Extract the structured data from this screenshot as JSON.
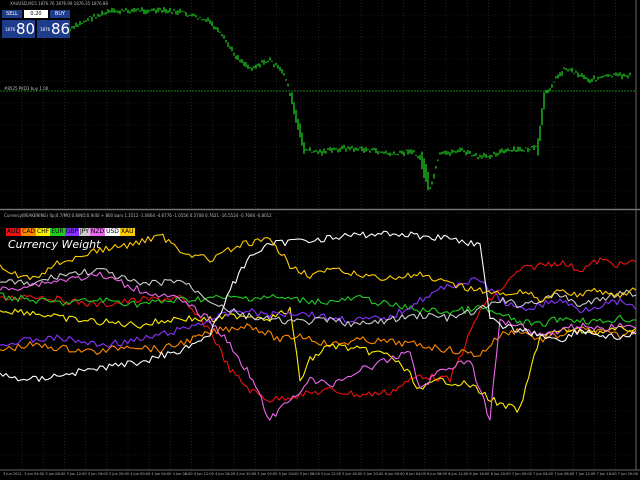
{
  "top_panel": {
    "header": "XAUUSD,M15 1876.76 1876.99 1876.35 1876.80",
    "trade": {
      "sell_label": "SELL",
      "buy_label": "BUY",
      "lot_value": "0.20",
      "sell_small": "1876",
      "sell_big": "80",
      "buy_small": "1876",
      "buy_big": "86"
    },
    "level_label": "#8525 PKD3 buy 1.00",
    "candle_color": "#22dd22",
    "level_color": "#22aa22"
  },
  "bottom_panel": {
    "header": "CurrencyWEAKENING( 0p;0.7/MO;0.8/NO;0.9/40 + 800 bars 1.3512 -1.0664 -4.6776 -1.0556 0.5708 0.7621 -16.5524 -0.7666 -0.8012",
    "title": "Currency Weight",
    "currencies": [
      {
        "name": "AUD",
        "color": "#ee1111"
      },
      {
        "name": "CAD",
        "color": "#ff8800"
      },
      {
        "name": "CHF",
        "color": "#ffee00"
      },
      {
        "name": "EUR",
        "color": "#22cc22"
      },
      {
        "name": "GBP",
        "color": "#8833ff"
      },
      {
        "name": "JPY",
        "color": "#cccccc"
      },
      {
        "name": "NZD",
        "color": "#ee66ee"
      },
      {
        "name": "USD",
        "color": "#ffffff"
      },
      {
        "name": "XAU",
        "color": "#ffcc00"
      }
    ]
  },
  "x_axis_labels": [
    "3 Jun 2021",
    "3 Jun 04:00",
    "3 Jun 08:00",
    "3 Jun 12:00",
    "3 Jun 16:00",
    "3 Jun 20:00",
    "4 Jun 00:00",
    "4 Jun 04:00",
    "4 Jun 08:00",
    "4 Jun 12:00",
    "4 Jun 16:00",
    "4 Jun 20:00",
    "5 Jun 00:00",
    "5 Jun 04:00",
    "5 Jun 08:00",
    "5 Jun 12:00",
    "5 Jun 16:00",
    "5 Jun 20:00",
    "6 Jun 00:00",
    "6 Jun 04:00",
    "6 Jun 08:00",
    "6 Jun 12:00",
    "6 Jun 16:00",
    "6 Jun 20:00",
    "7 Jun 00:00",
    "7 Jun 04:00",
    "7 Jun 08:00",
    "7 Jun 12:00",
    "7 Jun 16:00",
    "7 Jun 20:00"
  ]
}
